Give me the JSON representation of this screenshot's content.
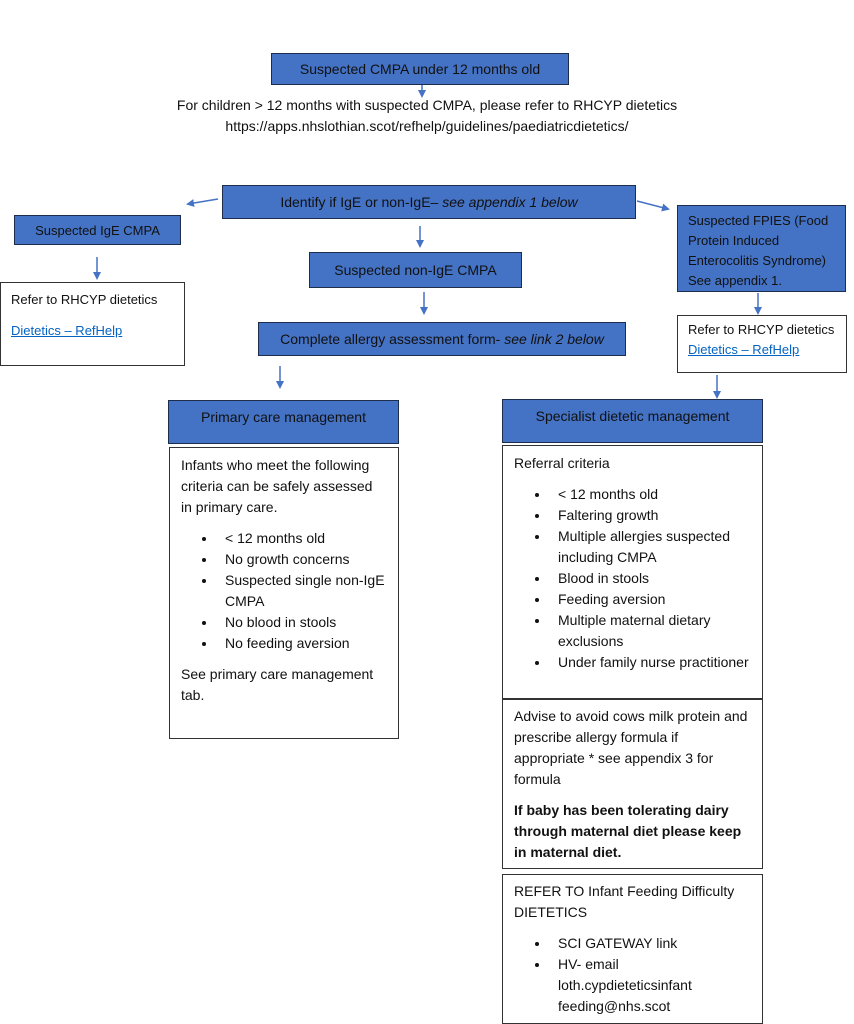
{
  "top_box": {
    "label": "Suspected CMPA under 12 months old"
  },
  "note": {
    "line1": "For children > 12 months with suspected CMPA, please refer to RHCYP dietetics",
    "line2": "https://apps.nhslothian.scot/refhelp/guidelines/paediatricdietetics/"
  },
  "identify_box": {
    "label": "Identify if IgE or non-IgE– ",
    "italic": "see appendix 1 below"
  },
  "ige_box": {
    "label": "Suspected IgE CMPA"
  },
  "ige_refer": {
    "text": "Refer to RHCYP dietetics",
    "link": "Dietetics – RefHelp"
  },
  "nonige_box": {
    "label": "Suspected non-IgE CMPA"
  },
  "assessment_box": {
    "label": "Complete allergy assessment form- ",
    "italic": "see link 2 below"
  },
  "fpies_box": {
    "label": "Suspected FPIES (Food Protein Induced Enterocolitis Syndrome) See appendix 1."
  },
  "fpies_refer": {
    "text": "Refer to RHCYP dietetics",
    "link": "Dietetics – RefHelp"
  },
  "primary": {
    "header": "Primary care management",
    "intro": "Infants who meet the following criteria can be safely assessed in primary care.",
    "criteria": [
      "< 12 months old",
      "No growth concerns",
      "Suspected single non-IgE CMPA",
      "No blood in stools",
      "No feeding aversion"
    ],
    "footer": "See primary care management tab."
  },
  "specialist": {
    "header": "Specialist dietetic management",
    "intro": "Referral criteria",
    "criteria": [
      "< 12 months old",
      "Faltering growth",
      "Multiple allergies suspected including CMPA",
      "Blood in stools",
      "Feeding aversion",
      "Multiple maternal dietary exclusions",
      "Under family nurse practitioner"
    ],
    "advice": "Advise to avoid cows milk protein and prescribe allergy formula if appropriate * see appendix 3 for formula",
    "advice_bold": "If baby has been tolerating dairy through maternal diet please keep in maternal diet.",
    "refer_title": "REFER TO Infant Feeding Difficulty DIETETICS",
    "refer_items": [
      "SCI GATEWAY link",
      "HV- email loth.cypdieteticsinfant feeding@nhs.scot"
    ]
  },
  "colors": {
    "box_blue": "#4472c4",
    "arrow_blue": "#4472c4",
    "link_blue": "#0563c1"
  }
}
